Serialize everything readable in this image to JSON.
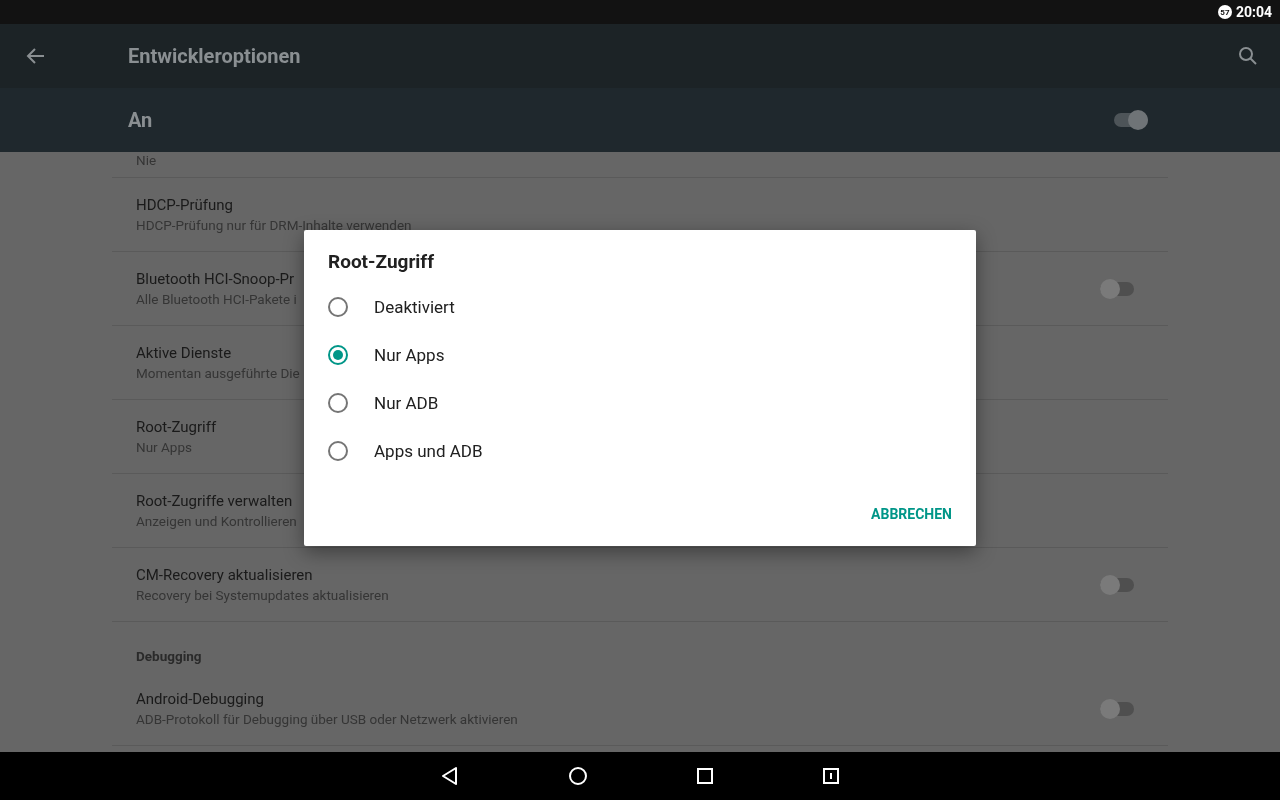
{
  "status_bar": {
    "badge": "57",
    "time": "20:04"
  },
  "toolbar": {
    "title": "Entwickleroptionen"
  },
  "master_switch": {
    "label": "An",
    "on": true
  },
  "settings": [
    {
      "kind": "tail",
      "subtitle": "Nie"
    },
    {
      "kind": "item",
      "title": "HDCP-Prüfung",
      "subtitle": "HDCP-Prüfung nur für DRM-Inhalte verwenden"
    },
    {
      "kind": "item",
      "title": "Bluetooth HCI-Snoop-Pr",
      "subtitle": "Alle Bluetooth HCI-Pakete i",
      "switch": {
        "on": false
      }
    },
    {
      "kind": "item",
      "title": "Aktive Dienste",
      "subtitle": "Momentan ausgeführte Die"
    },
    {
      "kind": "item",
      "title": "Root-Zugriff",
      "subtitle": "Nur Apps"
    },
    {
      "kind": "item",
      "title": "Root-Zugriffe verwalten",
      "subtitle": "Anzeigen und Kontrollieren"
    },
    {
      "kind": "item",
      "title": "CM-Recovery aktualisieren",
      "subtitle": "Recovery bei Systemupdates aktualisieren",
      "switch": {
        "on": false
      }
    },
    {
      "kind": "header",
      "title": "Debugging"
    },
    {
      "kind": "item",
      "title": "Android-Debugging",
      "subtitle": "ADB-Protokoll für Debugging über USB oder Netzwerk aktivieren",
      "switch": {
        "on": false
      }
    }
  ],
  "dialog": {
    "title": "Root-Zugriff",
    "options": [
      {
        "label": "Deaktiviert",
        "selected": false
      },
      {
        "label": "Nur Apps",
        "selected": true
      },
      {
        "label": "Nur ADB",
        "selected": false
      },
      {
        "label": "Apps und ADB",
        "selected": false
      }
    ],
    "buttons": [
      "ABBRECHEN"
    ]
  }
}
